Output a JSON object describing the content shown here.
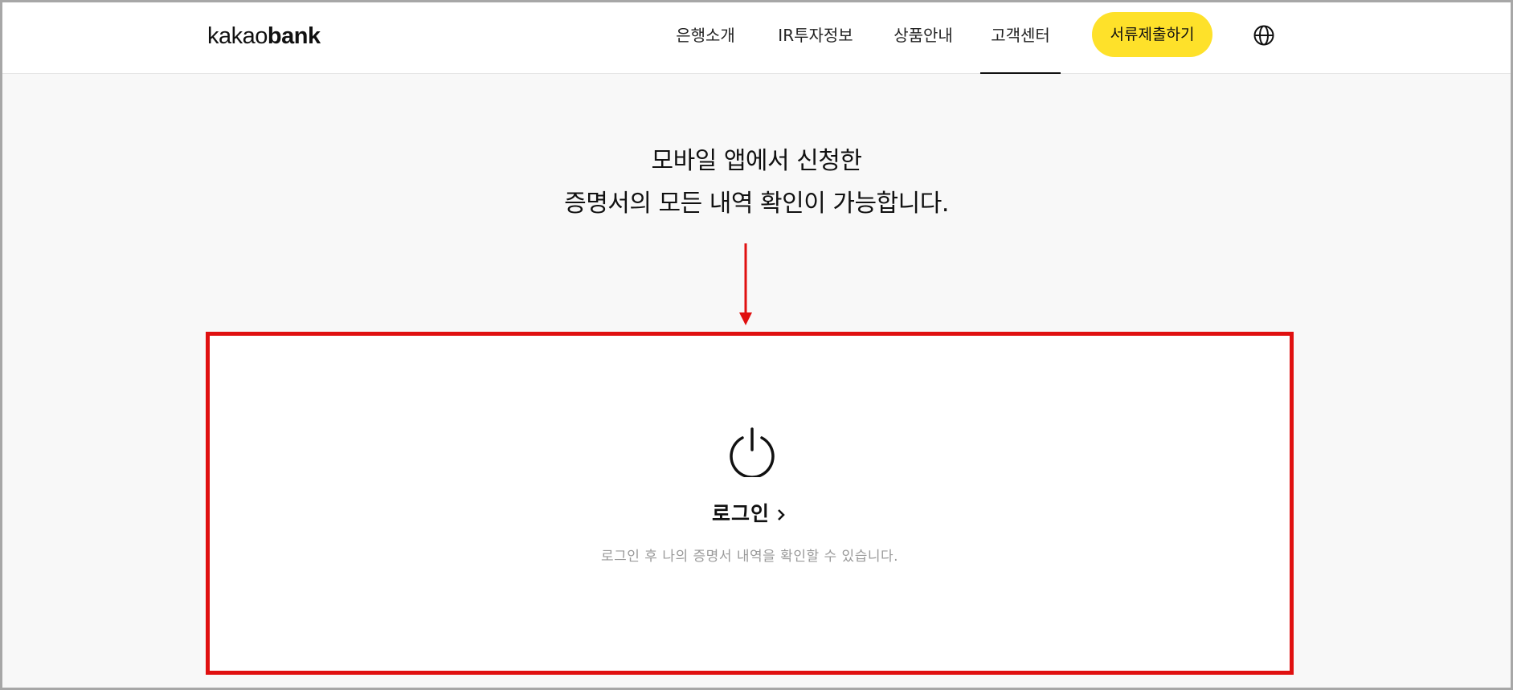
{
  "header": {
    "logo_light": "kakao",
    "logo_bold": "bank",
    "nav": [
      {
        "label": "은행소개"
      },
      {
        "label": "IR투자정보"
      },
      {
        "label": "상품안내"
      },
      {
        "label": "고객센터",
        "active": true
      }
    ],
    "cta_label": "서류제출하기",
    "language_icon": "globe-icon"
  },
  "main": {
    "headline_line1": "모바일 앱에서 신청한",
    "headline_line2": "증명서의 모든 내역 확인이 가능합니다.",
    "login_label": "로그인",
    "login_description": "로그인 후 나의 증명서 내역을 확인할 수 있습니다.",
    "icons": [
      "power-icon",
      "chevron-right-icon",
      "arrow-down-icon"
    ]
  },
  "colors": {
    "accent_yellow": "#fee12a",
    "highlight_red": "#e01010",
    "background": "#f8f8f8"
  }
}
